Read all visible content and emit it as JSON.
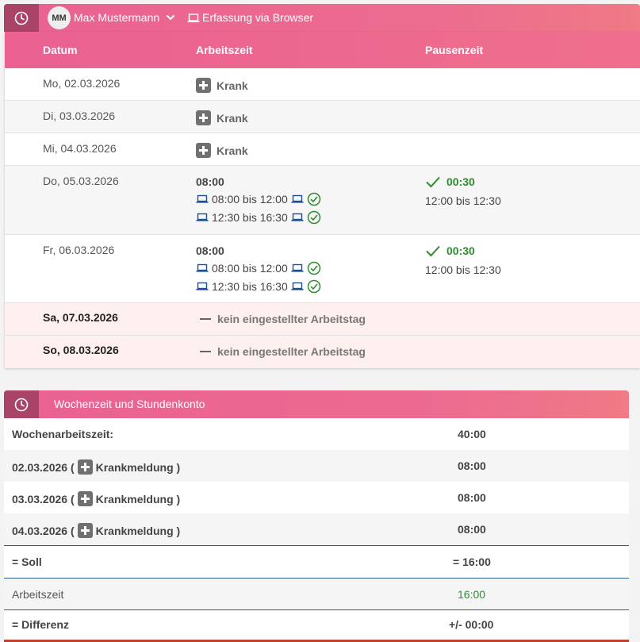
{
  "header": {
    "avatar_initials": "MM",
    "user_name": "Max Mustermann",
    "mode": "Erfassung via Browser"
  },
  "table": {
    "columns": [
      "Datum",
      "Arbeitszeit",
      "Pausenzeit"
    ],
    "rows": [
      {
        "date": "Mo, 02.03.2026",
        "status": "Krank"
      },
      {
        "date": "Di, 03.03.2026",
        "status": "Krank"
      },
      {
        "date": "Mi, 04.03.2026",
        "status": "Krank"
      },
      {
        "date": "Do, 05.03.2026",
        "total": "08:00",
        "intervals": [
          "08:00 bis 12:00",
          "12:30 bis 16:30"
        ],
        "pause": "00:30",
        "pause_range": "12:00 bis 12:30"
      },
      {
        "date": "Fr, 06.03.2026",
        "total": "08:00",
        "intervals": [
          "08:00 bis 12:00",
          "12:30 bis 16:30"
        ],
        "pause": "00:30",
        "pause_range": "12:00 bis 12:30"
      },
      {
        "date": "Sa, 07.03.2026",
        "note": "kein eingestellter Arbeitstag"
      },
      {
        "date": "So, 08.03.2026",
        "note": "kein eingestellter Arbeitstag"
      }
    ]
  },
  "summary": {
    "title": "Wochenzeit und Stundenkonto",
    "week_label": "Wochenarbeitszeit:",
    "week_value": "40:00",
    "sick_items": [
      {
        "date": "02.03.2026 (",
        "label": "Krankmeldung )",
        "value": "08:00"
      },
      {
        "date": "03.03.2026 (",
        "label": "Krankmeldung )",
        "value": "08:00"
      },
      {
        "date": "04.03.2026 (",
        "label": "Krankmeldung )",
        "value": "08:00"
      }
    ],
    "soll_label": "= Soll",
    "soll_value": "= 16:00",
    "work_label": "Arbeitszeit",
    "work_value": "16:00",
    "diff_label": "= Differenz",
    "diff_value": "+/- 00:00"
  },
  "colors": {
    "accent_pink": "#ea6192",
    "accent_dark": "#a94468",
    "ok_green": "#2e8b2e",
    "weekend_bg": "#fdf0ee",
    "icon_blue": "#1f4e96"
  }
}
